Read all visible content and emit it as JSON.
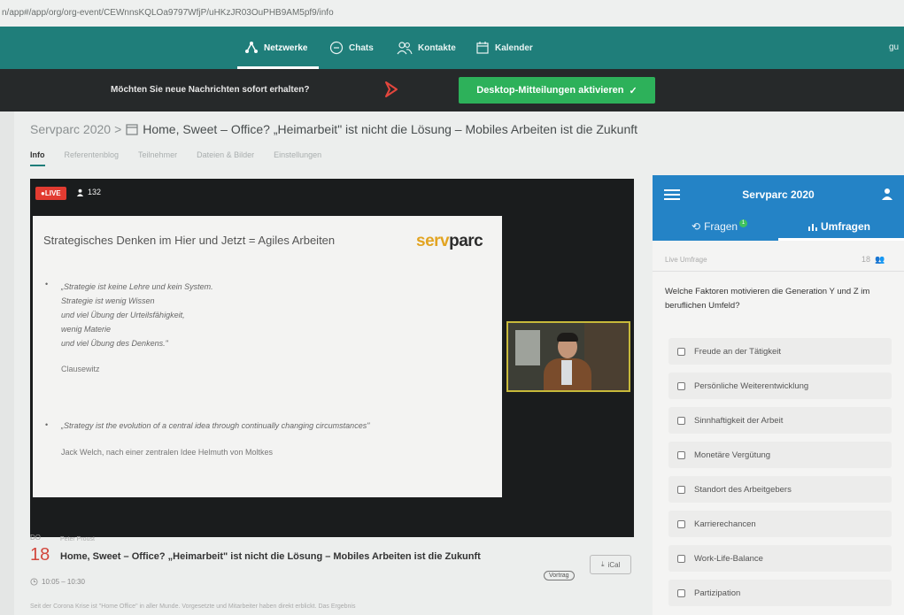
{
  "browser": {
    "url": "n/app#/app/org/org-event/CEWnnsKQLOa9797WfjP/uHKzJR03OuPHB9AM5pf9/info"
  },
  "topnav": {
    "items": [
      {
        "label": "Netzwerke",
        "icon": "network-icon"
      },
      {
        "label": "Chats",
        "icon": "chat-icon"
      },
      {
        "label": "Kontakte",
        "icon": "contacts-icon"
      },
      {
        "label": "Kalender",
        "icon": "calendar-icon"
      }
    ],
    "active": "Netzwerke",
    "user_initial": "gu"
  },
  "notification": {
    "message": "Möchten Sie neue Nachrichten sofort erhalten?",
    "button_label": "Desktop-Mitteilungen aktivieren"
  },
  "breadcrumb": {
    "parent": "Servparc 2020",
    "separator": ">",
    "title": "Home, Sweet – Office? „Heimarbeit\" ist nicht die Lösung – Mobiles Arbeiten ist die Zukunft"
  },
  "subtabs": [
    "Info",
    "Referentenblog",
    "Teilnehmer",
    "Dateien & Bilder",
    "Einstellungen"
  ],
  "stream": {
    "live_label": "LIVE",
    "viewers": "132",
    "slide": {
      "title": "Strategisches Denken im Hier und Jetzt = Agiles Arbeiten",
      "logo_part1": "serv",
      "logo_part2": "parc",
      "quote_lines": [
        "„Strategie ist keine Lehre und kein System.",
        "Strategie ist wenig Wissen",
        "und viel Übung der Urteilsfähigkeit,",
        "wenig Materie",
        "und viel Übung des Denkens.\""
      ],
      "quote_author": "Clausewitz",
      "quote2": "„Strategy ist the evolution of a central idea through continually changing circumstances\"",
      "quote2_author": "Jack Welch, nach einer zentralen Idee Helmuth von Moltkes"
    }
  },
  "session": {
    "day_label": "DO",
    "speaker": "Peter Proust",
    "day": "18",
    "title": "Home, Sweet – Office? „Heimarbeit\" ist nicht die Lösung – Mobiles Arbeiten ist die Zukunft",
    "type_pill": "Vortrag",
    "ical_label": "iCal",
    "time": "10:05 – 10:30",
    "description": "Seit der Corona Krise ist \"Home Office\" in aller Munde. Vorgesetzte und Mitarbeiter haben direkt erblickt. Das Ergebnis"
  },
  "panel": {
    "title": "Servparc 2020",
    "tabs": [
      {
        "label": "Fragen",
        "badge": "1"
      },
      {
        "label": "Umfragen"
      }
    ],
    "active_tab": "Umfragen",
    "live_label": "Live Umfrage",
    "count": "18",
    "question": "Welche Faktoren motivieren die Generation Y und Z im beruflichen Umfeld?",
    "options": [
      "Freude an der Tätigkeit",
      "Persönliche Weiterentwicklung",
      "Sinnhaftigkeit der Arbeit",
      "Monetäre Vergütung",
      "Standort des Arbeitgebers",
      "Karrierechancen",
      "Work-Life-Balance",
      "Partizipation"
    ]
  },
  "colors": {
    "nav_teal": "#1f7e7a",
    "notify_dark": "#26292a",
    "notify_button_green": "#2db15a",
    "panel_blue": "#2483c6",
    "live_red": "#e23b31",
    "logo_gold": "#e2a422"
  }
}
